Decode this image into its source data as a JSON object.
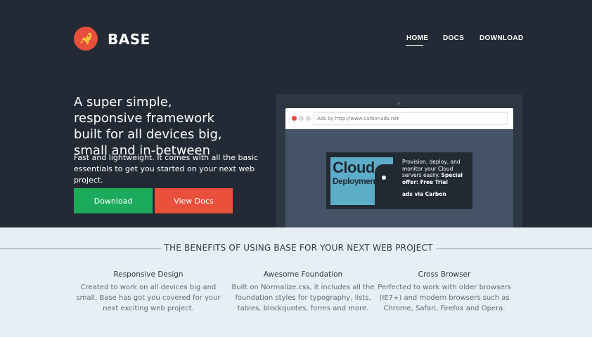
{
  "header": {
    "brand": "BASE",
    "nav": [
      "HOME",
      "DOCS",
      "DOWNLOAD"
    ],
    "active_nav": "HOME"
  },
  "hero": {
    "headline": "A super simple, responsive framework built for all devices big, small and in-between",
    "lead": "Fast and lightweight. It comes with all the basic essentials to get you started on your next web project.",
    "download_label": "Download",
    "docs_label": "View Docs"
  },
  "browser": {
    "address": "Ads by http://www.carbonads.net"
  },
  "ad": {
    "image_line1": "Cloud",
    "image_line2": "Deployment",
    "copy_plain": "Provision, deploy, and monitor your Cloud servers easily.",
    "copy_bold": "Special offer: Free Trial",
    "via": "ads via Carbon"
  },
  "benefits": {
    "title": "THE BENEFITS OF USING BASE FOR YOUR NEXT WEB PROJECT",
    "items": [
      {
        "title": "Responsive Design",
        "text": "Created to work on all devices big and small, Base has got you covered for your next exciting web project."
      },
      {
        "title": "Awesome Foundation",
        "text": "Built on Normalize.css, it includes all the foundation styles for typography, lists, tables, blockquotes, forms and more."
      },
      {
        "title": "Cross Browser",
        "text": "Perfected to work with older browsers (IE7+) and modern browsers such as Chrome, Safari, Firefox and Opera."
      }
    ]
  },
  "colors": {
    "hero_bg": "#232a35",
    "accent_red": "#e9503b",
    "accent_green": "#1cab5d",
    "benefits_bg": "#e8eff4"
  },
  "icons": {
    "logo": "rocket-icon"
  }
}
